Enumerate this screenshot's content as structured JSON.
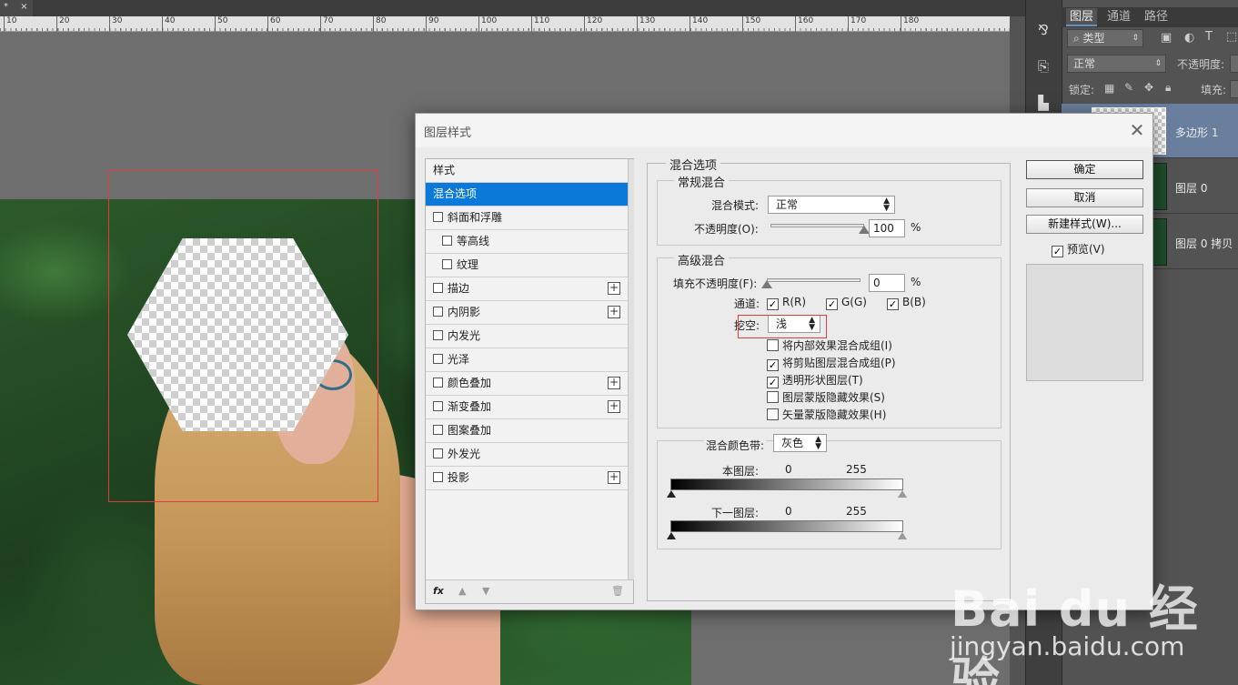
{
  "document": {
    "tab_close": "×",
    "ruler_ticks": [
      "10",
      "20",
      "30",
      "40",
      "50",
      "60",
      "70",
      "80",
      "90",
      "100",
      "110",
      "120",
      "130",
      "140",
      "150",
      "160",
      "170",
      "180"
    ]
  },
  "right_toolbar": {
    "icons": [
      "history-icon",
      "character-icon",
      "clone-source-icon"
    ]
  },
  "layers_panel": {
    "tabs": [
      "图层",
      "通道",
      "路径"
    ],
    "filter_kind": "类型",
    "blend_mode": "正常",
    "opacity_label": "不透明度:",
    "lock_label": "锁定:",
    "fill_label": "填充:",
    "layers": [
      {
        "name": "多边形 1",
        "selected": true
      },
      {
        "name": "图层 0",
        "selected": false
      },
      {
        "name": "图层 0 拷贝",
        "selected": false
      }
    ]
  },
  "dialog": {
    "title": "图层样式",
    "close": "✕",
    "styles_list": {
      "header": "样式",
      "items": [
        {
          "label": "混合选项",
          "checkbox": false,
          "plus": false,
          "selected": true,
          "indent": false
        },
        {
          "label": "斜面和浮雕",
          "checkbox": true,
          "plus": false,
          "selected": false,
          "indent": false
        },
        {
          "label": "等高线",
          "checkbox": true,
          "plus": false,
          "selected": false,
          "indent": true
        },
        {
          "label": "纹理",
          "checkbox": true,
          "plus": false,
          "selected": false,
          "indent": true
        },
        {
          "label": "描边",
          "checkbox": true,
          "plus": true,
          "selected": false,
          "indent": false
        },
        {
          "label": "内阴影",
          "checkbox": true,
          "plus": true,
          "selected": false,
          "indent": false
        },
        {
          "label": "内发光",
          "checkbox": true,
          "plus": false,
          "selected": false,
          "indent": false
        },
        {
          "label": "光泽",
          "checkbox": true,
          "plus": false,
          "selected": false,
          "indent": false
        },
        {
          "label": "颜色叠加",
          "checkbox": true,
          "plus": true,
          "selected": false,
          "indent": false
        },
        {
          "label": "渐变叠加",
          "checkbox": true,
          "plus": true,
          "selected": false,
          "indent": false
        },
        {
          "label": "图案叠加",
          "checkbox": true,
          "plus": false,
          "selected": false,
          "indent": false
        },
        {
          "label": "外发光",
          "checkbox": true,
          "plus": false,
          "selected": false,
          "indent": false
        },
        {
          "label": "投影",
          "checkbox": true,
          "plus": true,
          "selected": false,
          "indent": false
        }
      ],
      "footer": {
        "fx": "fx",
        "up": "▲",
        "down": "▼",
        "trash": "🗑"
      }
    },
    "blending": {
      "group_title": "混合选项",
      "general": {
        "title": "常规混合",
        "mode_label": "混合模式:",
        "mode_value": "正常",
        "opacity_label": "不透明度(O):",
        "opacity_value": "100",
        "opacity_pct": 1.0,
        "percent": "%"
      },
      "advanced": {
        "title": "高级混合",
        "fill_label": "填充不透明度(F):",
        "fill_value": "0",
        "fill_pct": 0.0,
        "percent": "%",
        "channels_label": "通道:",
        "channel_r": "R(R)",
        "channel_g": "G(G)",
        "channel_b": "B(B)",
        "knockout_label": "挖空:",
        "knockout_value": "浅",
        "options": [
          {
            "label": "将内部效果混合成组(I)",
            "checked": false
          },
          {
            "label": "将剪贴图层混合成组(P)",
            "checked": true
          },
          {
            "label": "透明形状图层(T)",
            "checked": true
          },
          {
            "label": "图层蒙版隐藏效果(S)",
            "checked": false
          },
          {
            "label": "矢量蒙版隐藏效果(H)",
            "checked": false
          }
        ]
      },
      "blend_if": {
        "label": "混合颜色带:",
        "value": "灰色",
        "this_layer_label": "本图层:",
        "this_low": "0",
        "this_high": "255",
        "under_layer_label": "下一图层:",
        "under_low": "0",
        "under_high": "255"
      }
    },
    "buttons": {
      "ok": "确定",
      "cancel": "取消",
      "new_style": "新建样式(W)...",
      "preview_label": "预览(V)",
      "preview_checked": true
    }
  },
  "watermark": {
    "logo": "Bai du 经验",
    "url": "jingyan.baidu.com"
  }
}
